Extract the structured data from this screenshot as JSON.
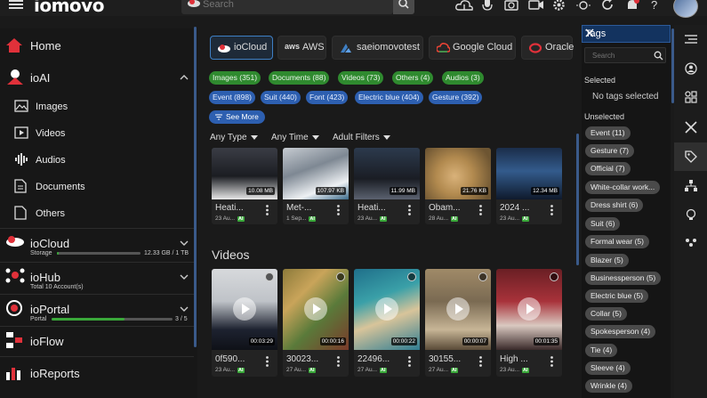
{
  "header": {
    "logo": "iomovo",
    "search_placeholder": "Search"
  },
  "sidebar": {
    "home": "Home",
    "ioai": "ioAI",
    "ioai_items": [
      "Images",
      "Videos",
      "Audios",
      "Documents",
      "Others"
    ],
    "iocloud": {
      "label": "ioCloud",
      "sub": "Storage",
      "value": "12.33 GB / 1 TB",
      "progress": 0.012
    },
    "iohub": {
      "label": "ioHub",
      "sub": "Total 10 Account(s)"
    },
    "ioportal": {
      "label": "ioPortal",
      "sub": "Portal",
      "value": "3 / 5",
      "progress": 0.6
    },
    "ioflow": "ioFlow",
    "ioreports": "ioReports"
  },
  "cloud_tabs": [
    "ioCloud",
    "AWS",
    "saeiomovotest",
    "Google Cloud",
    "Oracle"
  ],
  "chips_green": [
    "Images (351)",
    "Documents (88)",
    "Videos (73)",
    "Others (4)",
    "Audios (3)"
  ],
  "chips_blue": [
    "Event (898)",
    "Suit (440)",
    "Font (423)",
    "Electric blue (404)",
    "Gesture (392)"
  ],
  "see_more": "See More",
  "filters": [
    "Any Type",
    "Any Time",
    "Adult Filters"
  ],
  "images": [
    {
      "name": "Heati...",
      "date": "23 Au...",
      "size": "10.08 MB"
    },
    {
      "name": "Met-...",
      "date": "1 Sep...",
      "size": "107.97 KB"
    },
    {
      "name": "Heati...",
      "date": "23 Au...",
      "size": "11.99 MB"
    },
    {
      "name": "Obam...",
      "date": "28 Au...",
      "size": "21.76 KB"
    },
    {
      "name": "2024 ...",
      "date": "23 Au...",
      "size": "12.34 MB"
    }
  ],
  "videos_title": "Videos",
  "videos": [
    {
      "name": "0f590...",
      "date": "23 Au...",
      "duration": "00:03:29"
    },
    {
      "name": "30023...",
      "date": "27 Au...",
      "duration": "00:00:16"
    },
    {
      "name": "22496...",
      "date": "27 Au...",
      "duration": "00:00:22"
    },
    {
      "name": "30155...",
      "date": "27 Au...",
      "duration": "00:00:07"
    },
    {
      "name": "High ...",
      "date": "23 Au...",
      "duration": "00:01:35"
    }
  ],
  "ai_badge": "AI",
  "tags_panel": {
    "title": "Tags",
    "search_placeholder": "Search",
    "selected_label": "Selected",
    "no_tags": "No tags selected",
    "unselected_label": "Unselected",
    "unselected": [
      "Event (11)",
      "Gesture (7)",
      "Official (7)",
      "White-collar work...",
      "Dress shirt (6)",
      "Suit (6)",
      "Formal wear (5)",
      "Blazer (5)",
      "Businessperson (5)",
      "Electric blue (5)",
      "Collar (5)",
      "Spokesperson (4)",
      "Tie (4)",
      "Sleeve (4)",
      "Wrinkle (4)"
    ]
  },
  "colors": {
    "accent": "#2d5fb0",
    "green": "#2f8a2f",
    "brand_red": "#e0313a"
  }
}
